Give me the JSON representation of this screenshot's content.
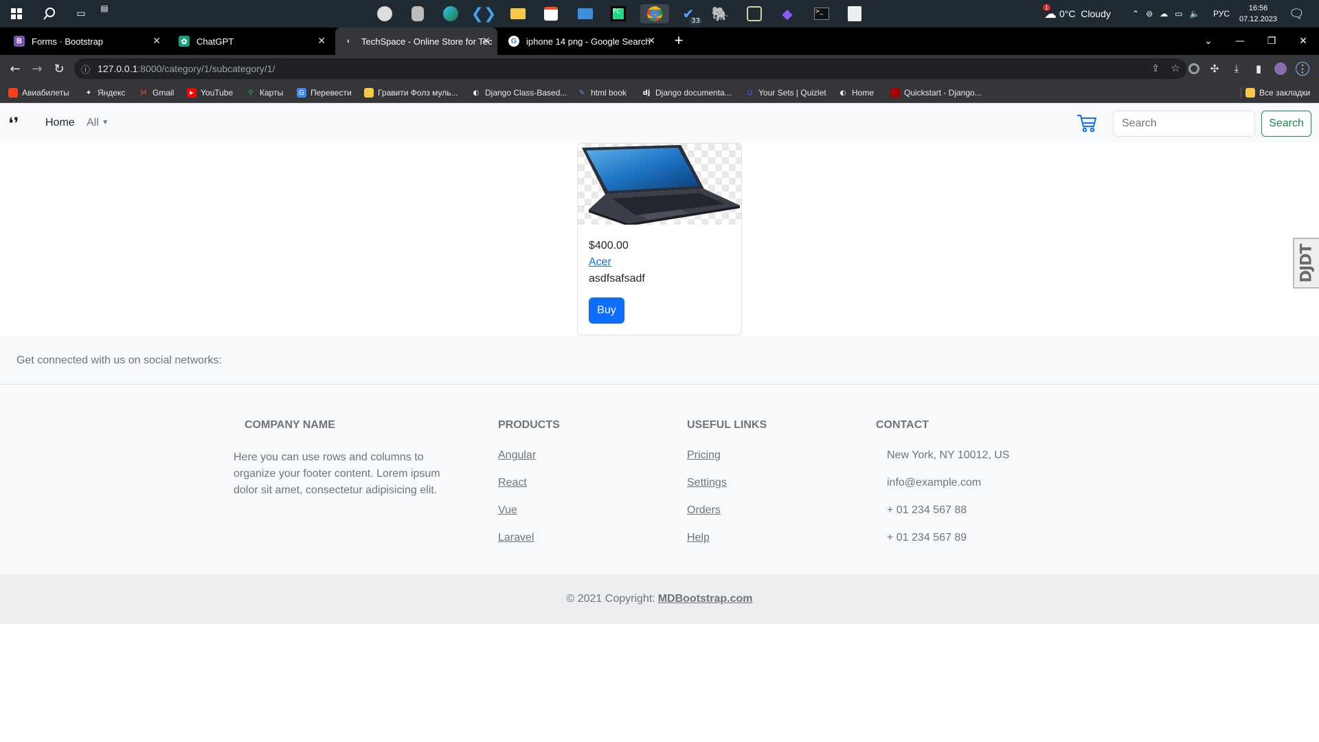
{
  "taskbar": {
    "weather": "0°C  Cloudy",
    "weather_badge": "1",
    "lang": "РУС",
    "time": "16:56",
    "date": "07.12.2023",
    "todo_badge": "33"
  },
  "browser": {
    "tabs": [
      {
        "title": "Forms · Bootstrap",
        "favicon": "B"
      },
      {
        "title": "ChatGPT",
        "favicon": "✿"
      },
      {
        "title": "TechSpace - Online Store for Tec",
        "favicon": "◐"
      },
      {
        "title": "iphone 14 png - Google Search",
        "favicon": "G"
      }
    ],
    "url_host": "127.0.0.1",
    "url_rest": ":8000/category/1/subcategory/1/",
    "bookmarks": [
      "Авиабилеты",
      "Яндекс",
      "Gmail",
      "YouTube",
      "Карты",
      "Перевести",
      "Гравити Фолз муль...",
      "Django Class-Based...",
      "html book",
      "Django documenta...",
      "Your Sets | Quizlet",
      "Home",
      "Quickstart - Django..."
    ],
    "all_bookmarks": "Все закладки"
  },
  "navbar": {
    "home": "Home",
    "all": "All",
    "search_placeholder": "Search",
    "search_button": "Search"
  },
  "product": {
    "price": "$400.00",
    "brand": "Acer",
    "description": "asdfsafsadf",
    "buy": "Buy"
  },
  "debug_toolbar": "DJDT",
  "footer": {
    "social_text": "Get connected with us on social networks:",
    "company": {
      "heading": "Company name",
      "text": "Here you can use rows and columns to organize your footer content. Lorem ipsum dolor sit amet, consectetur adipisicing elit."
    },
    "products": {
      "heading": "Products",
      "links": [
        "Angular",
        "React",
        "Vue",
        "Laravel"
      ]
    },
    "useful": {
      "heading": "Useful links",
      "links": [
        "Pricing",
        "Settings",
        "Orders",
        "Help"
      ]
    },
    "contact": {
      "heading": "Contact",
      "items": [
        "New York, NY 10012, US",
        "info@example.com",
        "+ 01 234 567 88",
        "+ 01 234 567 89"
      ]
    },
    "copyright_prefix": "© 2021 Copyright:",
    "copyright_link": "MDBootstrap.com"
  },
  "colors": {
    "primary": "#0d6efd",
    "success": "#198754",
    "muted": "#6c757d"
  }
}
